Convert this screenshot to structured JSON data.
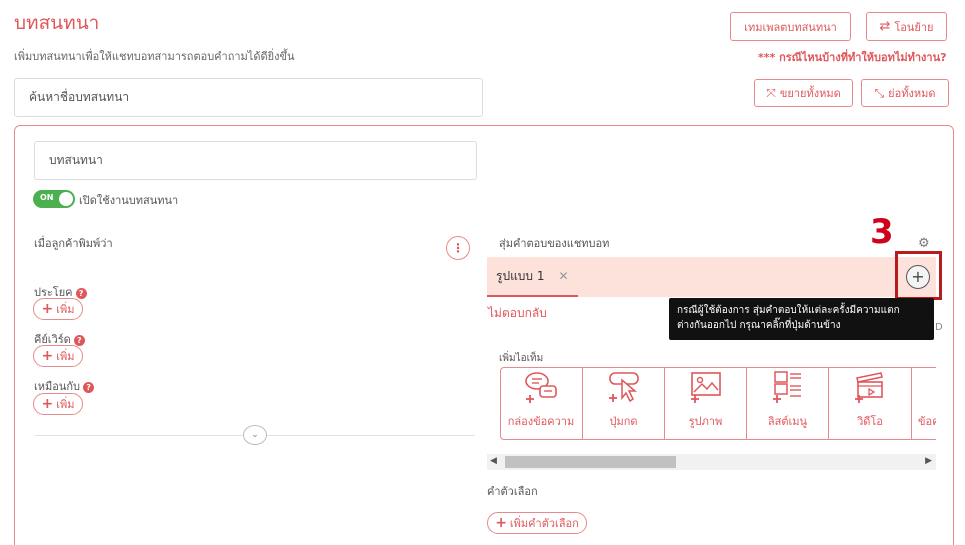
{
  "header": {
    "title": "บทสนทนา",
    "subtitle": "เพิ่มบทสนทนาเพื่อให้แชทบอทสามารถตอบคำถามได้ดียิ่งขึ้น",
    "template_button": "เทมเพลตบทสนทนา",
    "transfer_button": "โอนย้าย",
    "warning_link": "*** กรณีไหนบ้างที่ทำให้บอทไม่ทำงาน?",
    "expand_all": "ขยายทั้งหมด",
    "collapse_all": "ย่อทั้งหมด"
  },
  "search": {
    "placeholder": "ค้นหาชื่อบทสนทนา"
  },
  "conversation": {
    "name_value": "บทสนทนา",
    "toggle_state": "ON",
    "toggle_label": "เปิดใช้งานบทสนทนา",
    "when_customer_types": "เมื่อลูกค้าพิมพ์ว่า",
    "sentence_label": "ประโยค",
    "keyword_label": "คีย์เวิร์ด",
    "similar_label": "เหมือนกับ",
    "add_label": "เพิ่ม",
    "question_mark": "?"
  },
  "responses": {
    "title": "สุ่มคำตอบของแชทบอท",
    "tab_label": "รูปแบบ 1",
    "no_reply": "ไม่ตอบกลับ",
    "add_item_label": "เพิ่มไอเท็ม",
    "items": [
      {
        "label": "กล่องข้อความ",
        "icon": "chat-bubble-icon"
      },
      {
        "label": "ปุ่มกด",
        "icon": "button-click-icon"
      },
      {
        "label": "รูปภาพ",
        "icon": "image-icon"
      },
      {
        "label": "ลิสต์เมนู",
        "icon": "list-menu-icon"
      },
      {
        "label": "วิดีโอ",
        "icon": "video-icon"
      },
      {
        "label": "ข้อค",
        "icon": "text-icon"
      }
    ],
    "choices_label": "คำตัวเลือก",
    "add_choice": "เพิ่มคำตัวเลือก"
  },
  "annotation": {
    "step_number": "3",
    "tooltip_line1": "กรณีผู้ใช้ต้องการ สุ่มคำตอบให้แต่ละครั้งมีความแตก",
    "tooltip_line2": "ต่างกันออกไป กรุณาคลิ๊กที่ปุ่มด้านข้าง",
    "partial_char": "D"
  },
  "colors": {
    "accent": "#e0575b",
    "toggle_green": "#4caf50",
    "tab_bg": "#fde2dc",
    "annotation_red": "#d0021b"
  }
}
